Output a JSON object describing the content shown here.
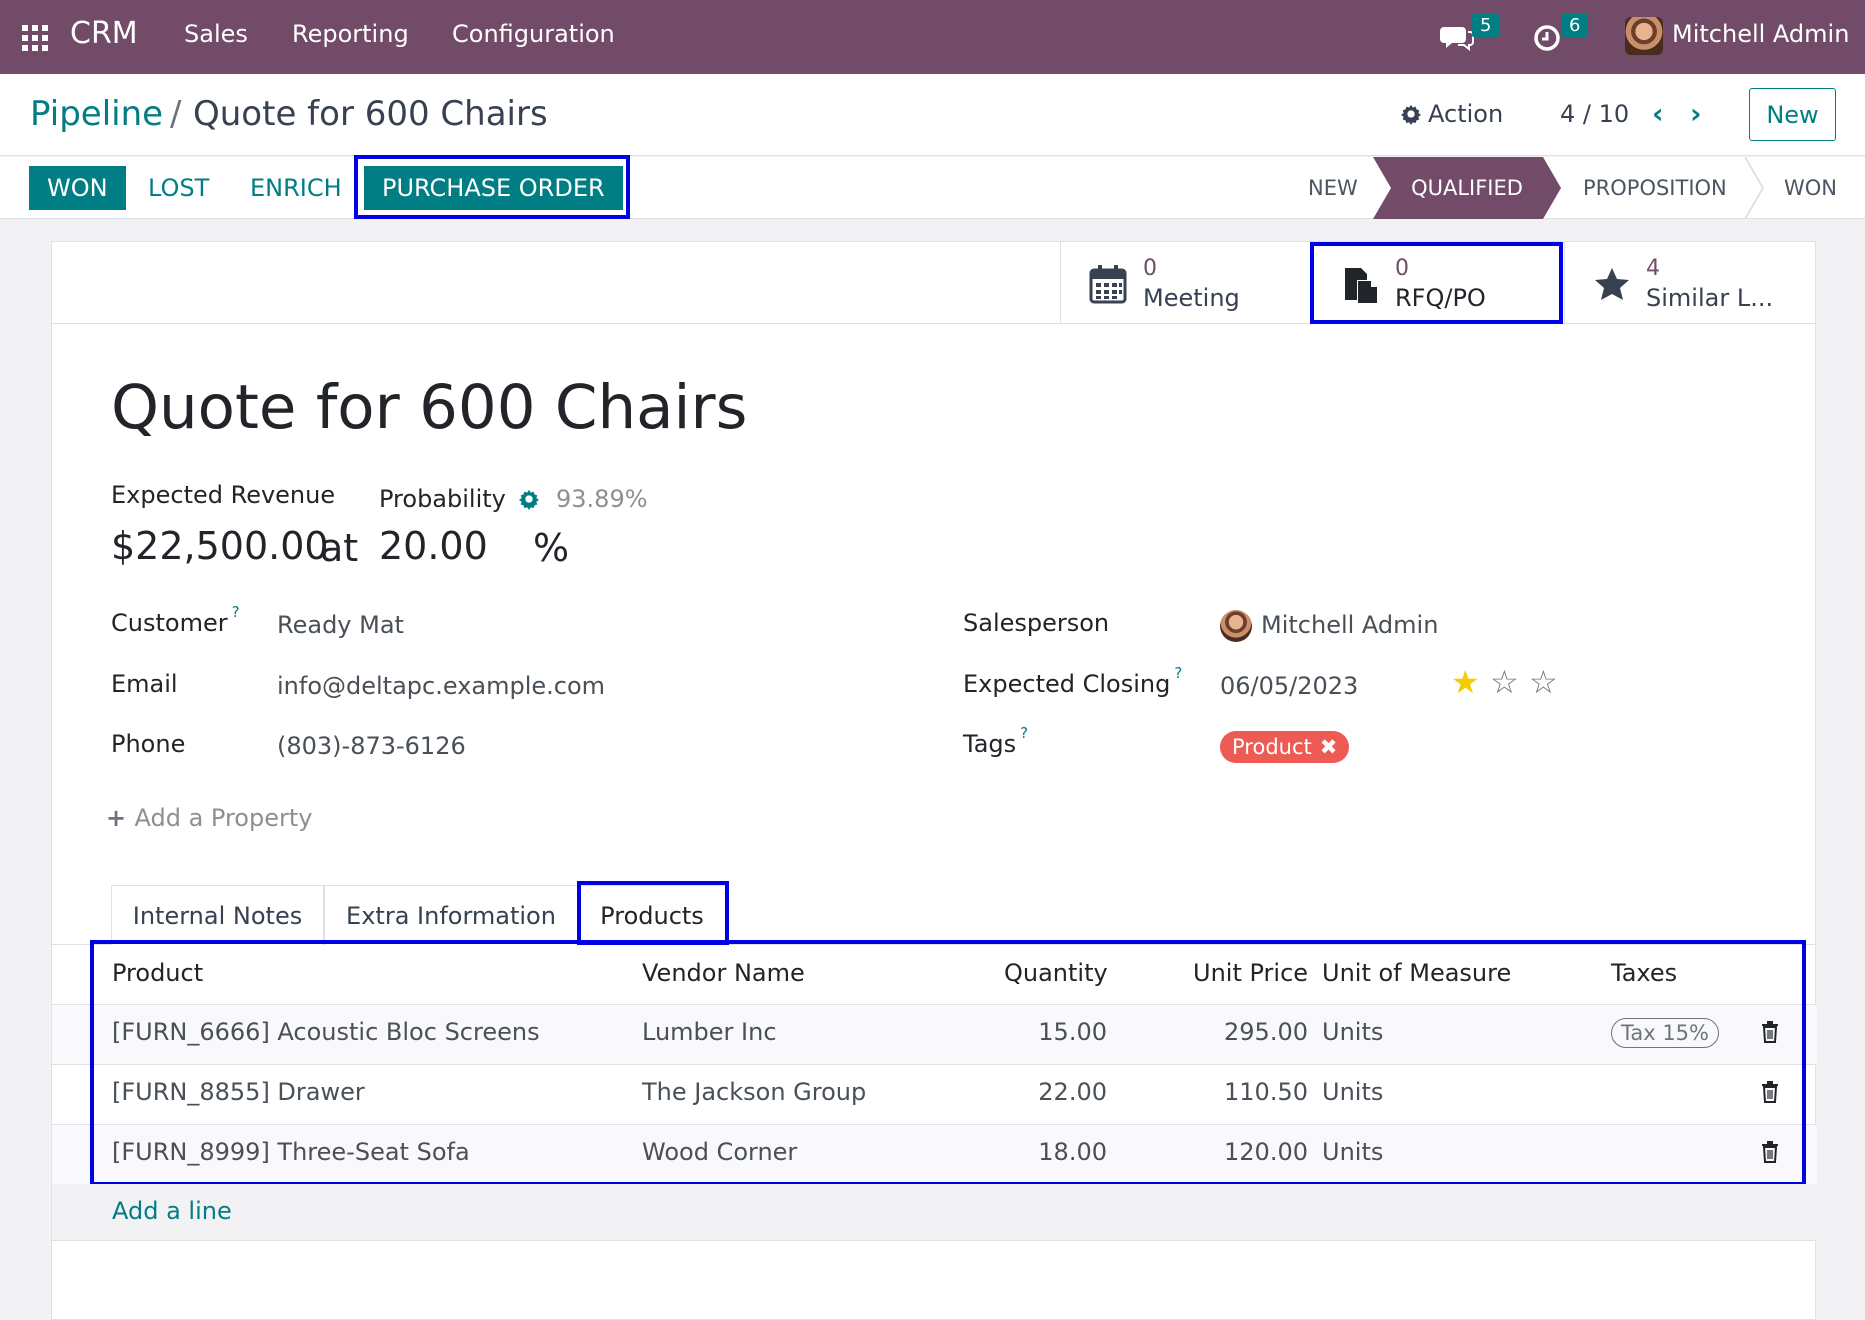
{
  "navbar": {
    "app_name": "CRM",
    "menu": [
      "Sales",
      "Reporting",
      "Configuration"
    ],
    "messages_count": "5",
    "activities_count": "6",
    "user_name": "Mitchell Admin"
  },
  "control_panel": {
    "breadcrumb_parent": "Pipeline",
    "breadcrumb_separator": "/",
    "breadcrumb_current": "Quote for 600 Chairs",
    "action_label": "Action",
    "pager": "4 / 10",
    "new_label": "New"
  },
  "status_bar": {
    "buttons": {
      "won": "WON",
      "lost": "LOST",
      "enrich": "ENRICH",
      "purchase_order": "PURCHASE ORDER"
    },
    "stages": [
      "NEW",
      "QUALIFIED",
      "PROPOSITION",
      "WON"
    ],
    "active_stage": "QUALIFIED"
  },
  "smart_buttons": {
    "meeting": {
      "value": "0",
      "label": "Meeting"
    },
    "rfq": {
      "value": "0",
      "label": "RFQ/PO"
    },
    "similar": {
      "value": "4",
      "label": "Similar L..."
    }
  },
  "form": {
    "title": "Quote for 600 Chairs",
    "expected_revenue_label": "Expected Revenue",
    "expected_revenue": "$22,500.00",
    "at_label": "at",
    "probability_label": "Probability",
    "probability_auto": "93.89%",
    "probability": "20.00",
    "percent_sign": "%",
    "customer_label": "Customer",
    "customer": "Ready Mat",
    "email_label": "Email",
    "email": "info@deltapc.example.com",
    "phone_label": "Phone",
    "phone": "(803)-873-6126",
    "salesperson_label": "Salesperson",
    "salesperson": "Mitchell Admin",
    "expected_closing_label": "Expected Closing",
    "expected_closing": "06/05/2023",
    "priority_stars": 1,
    "priority_max": 3,
    "tags_label": "Tags",
    "tags": [
      "Product"
    ],
    "add_property": "Add a Property",
    "help_mark": "?"
  },
  "tabs": [
    "Internal Notes",
    "Extra Information",
    "Products"
  ],
  "active_tab": "Products",
  "products_table": {
    "columns": [
      "Product",
      "Vendor Name",
      "Quantity",
      "Unit Price",
      "Unit of Measure",
      "Taxes"
    ],
    "rows": [
      {
        "product": "[FURN_6666] Acoustic Bloc Screens",
        "vendor": "Lumber Inc",
        "quantity": "15.00",
        "unit_price": "295.00",
        "uom": "Units",
        "taxes": "Tax 15%"
      },
      {
        "product": "[FURN_8855] Drawer",
        "vendor": "The Jackson Group",
        "quantity": "22.00",
        "unit_price": "110.50",
        "uom": "Units",
        "taxes": ""
      },
      {
        "product": "[FURN_8999] Three-Seat Sofa",
        "vendor": "Wood Corner",
        "quantity": "18.00",
        "unit_price": "120.00",
        "uom": "Units",
        "taxes": ""
      }
    ],
    "add_line": "Add a line"
  },
  "colors": {
    "brand": "#714b67",
    "accent": "#017e84",
    "highlight": "#0000e6",
    "tag": "#ee5b54",
    "star": "#f3cc00"
  }
}
